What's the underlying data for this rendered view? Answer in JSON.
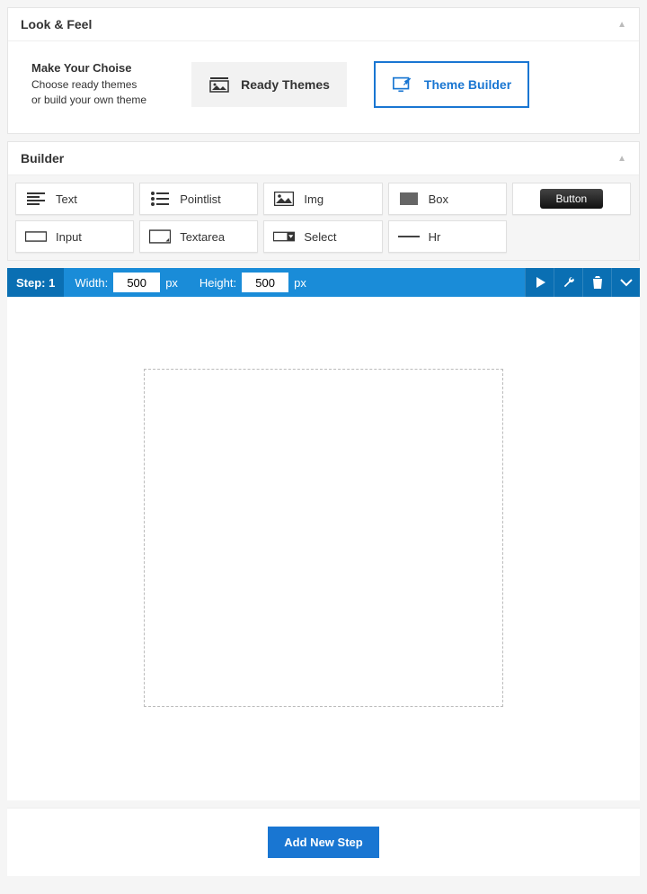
{
  "look_feel": {
    "title": "Look & Feel",
    "make_title": "Make Your Choise",
    "make_sub1": "Choose ready themes",
    "make_sub2": "or build your own theme",
    "ready_label": "Ready Themes",
    "builder_label": "Theme Builder"
  },
  "builder": {
    "title": "Builder",
    "tools": {
      "text": "Text",
      "pointlist": "Pointlist",
      "img": "Img",
      "box": "Box",
      "button": "Button",
      "input": "Input",
      "textarea": "Textarea",
      "select": "Select",
      "hr": "Hr"
    }
  },
  "step": {
    "label": "Step: 1",
    "width_label": "Width:",
    "width_value": "500",
    "width_unit": "px",
    "height_label": "Height:",
    "height_value": "500",
    "height_unit": "px"
  },
  "footer": {
    "add_step": "Add New Step"
  }
}
